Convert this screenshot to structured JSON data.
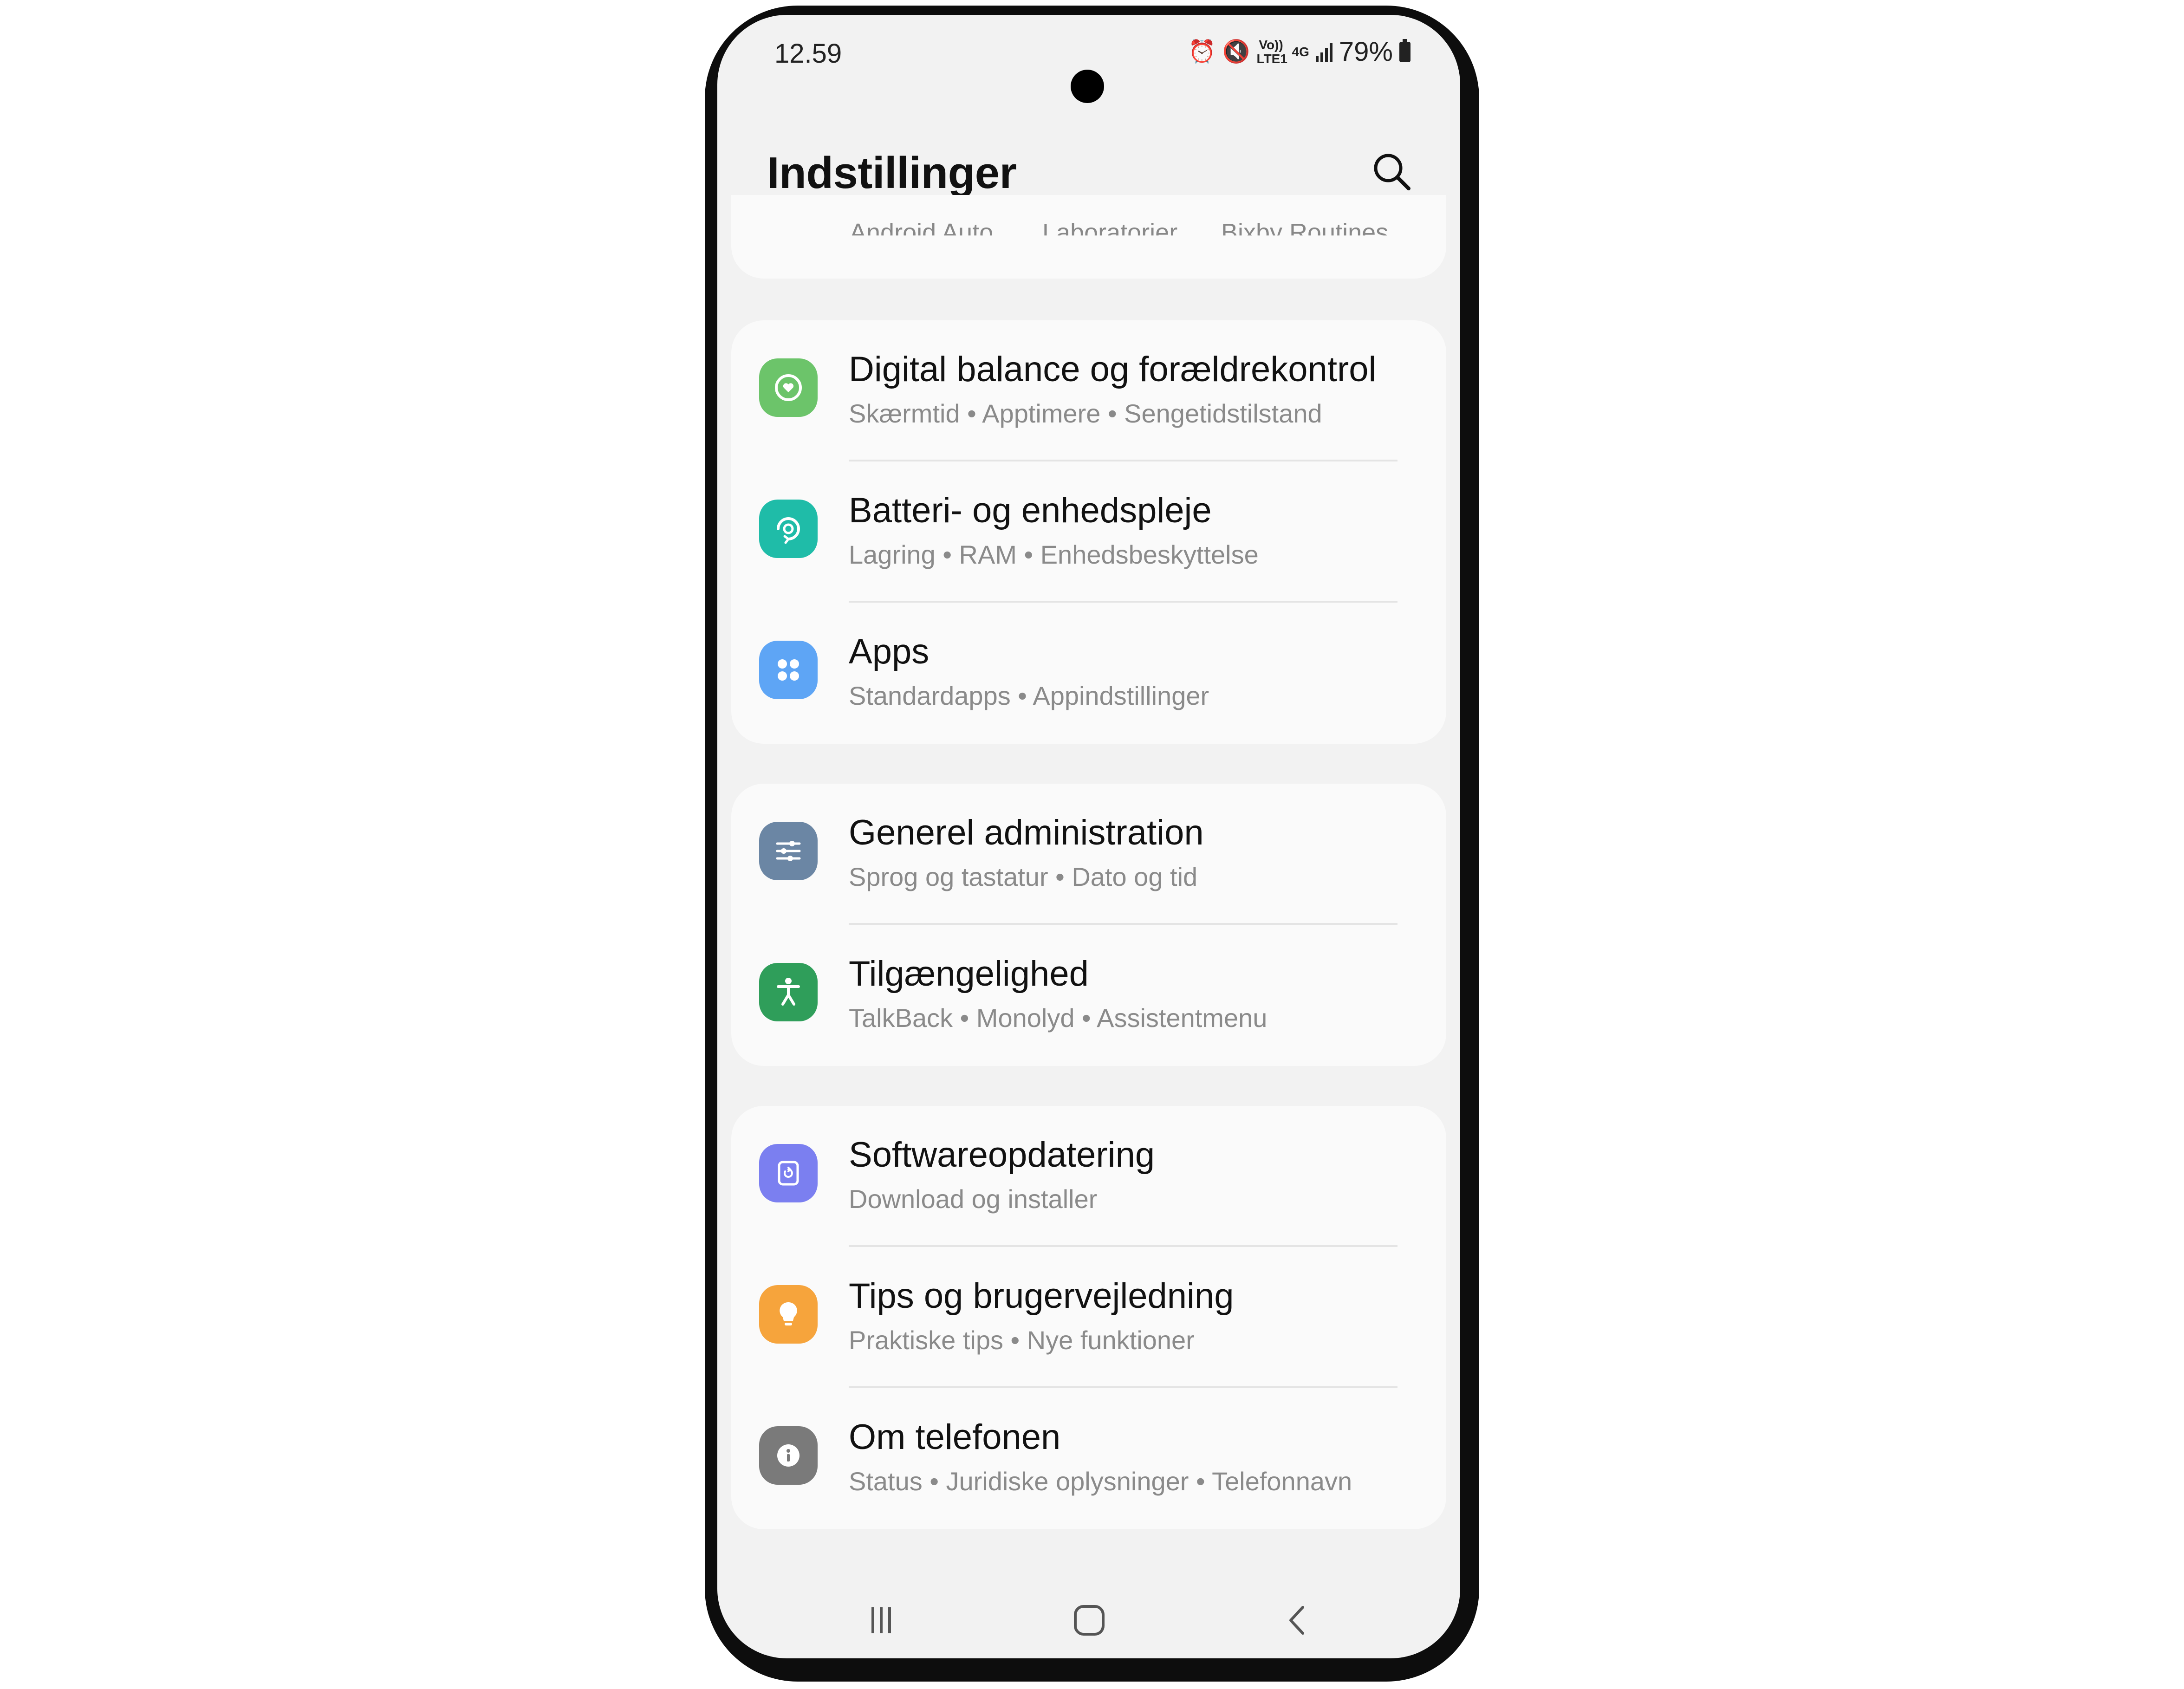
{
  "status_bar": {
    "time": "12.59",
    "volte_label": "Vo)) LTE1",
    "network_label": "4G",
    "battery_percent": "79%"
  },
  "header": {
    "title": "Indstillinger"
  },
  "cut_off_items": [
    "Android Auto",
    "Laboratorier",
    "Bixby Routines"
  ],
  "groups": [
    {
      "items": [
        {
          "title": "Digital balance og forældrekontrol",
          "subtitle": "Skærmtid  •  Apptimere  •  Sengetidstilstand",
          "icon": "digital-wellbeing-icon",
          "color": "#6cc46a"
        },
        {
          "title": "Batteri- og enhedspleje",
          "subtitle": "Lagring  •  RAM  •  Enhedsbeskyttelse",
          "icon": "device-care-icon",
          "color": "#1fbca8"
        },
        {
          "title": "Apps",
          "subtitle": "Standardapps  •  Appindstillinger",
          "icon": "apps-icon",
          "color": "#5ea5f5"
        }
      ]
    },
    {
      "items": [
        {
          "title": "Generel administration",
          "subtitle": "Sprog og tastatur  •  Dato og tid",
          "icon": "general-management-icon",
          "color": "#6b86a4"
        },
        {
          "title": "Tilgængelighed",
          "subtitle": "TalkBack  •  Monolyd  •  Assistentmenu",
          "icon": "accessibility-icon",
          "color": "#2f9e5a"
        }
      ]
    },
    {
      "items": [
        {
          "title": "Softwareopdatering",
          "subtitle": "Download og installer",
          "icon": "software-update-icon",
          "color": "#7b7ff0"
        },
        {
          "title": "Tips og brugervejledning",
          "subtitle": "Praktiske tips  •  Nye funktioner",
          "icon": "tips-lightbulb-icon",
          "color": "#f6a43c"
        },
        {
          "title": "Om telefonen",
          "subtitle": "Status  •  Juridiske oplysninger  •  Telefonnavn",
          "icon": "info-icon",
          "color": "#7a7a7a"
        }
      ]
    }
  ],
  "nav_bar": {
    "recents": "recents-icon",
    "home": "home-icon",
    "back": "back-icon"
  }
}
